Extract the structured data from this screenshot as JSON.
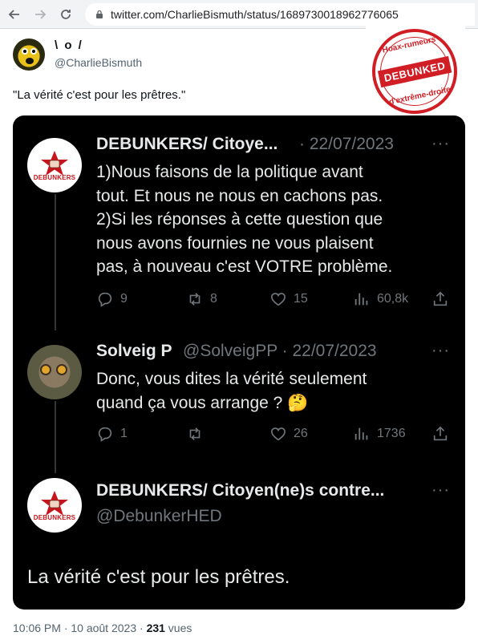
{
  "browser": {
    "url": "twitter.com/CharlieBismuth/status/1689730018962776065"
  },
  "tweet": {
    "display_name": "\\ o /",
    "handle": "@CharlieBismuth",
    "text": "\"La vérité c'est pour les prêtres.\"",
    "time": "10:06 PM · 10 août 2023 · ",
    "views_count": "231",
    "views_label": " vues"
  },
  "stamp": {
    "top": "Hoax-rumeurs",
    "band": "DEBUNKED",
    "bottom": "d'extrême-droite",
    "color": "#d11d24"
  },
  "embedded": {
    "avatar_label": "DEBUNKERS",
    "tweets": [
      {
        "name": "DEBUNKERS/ Citoye...",
        "meta": "· 22/07/2023",
        "lines": [
          "1)Nous faisons de la politique avant",
          "tout. Et nous ne nous en cachons pas.",
          "2)Si les réponses à cette question que",
          "nous avons fournies ne vous plaisent",
          "pas, à nouveau c'est VOTRE problème."
        ],
        "replies": "9",
        "retweets": "8",
        "likes": "15",
        "views": "60,8k"
      },
      {
        "name": "Solveig P",
        "meta": "@SolveigPP · 22/07/2023",
        "lines": [
          "Donc, vous dites la vérité seulement",
          "quand ça vous arrange ? 🤔"
        ],
        "replies": "1",
        "retweets": "",
        "likes": "26",
        "views": "1736"
      }
    ],
    "main": {
      "name": "DEBUNKERS/ Citoyen(ne)s contre...",
      "handle": "@DebunkerHED",
      "text": "La vérité c'est pour les prêtres."
    }
  }
}
